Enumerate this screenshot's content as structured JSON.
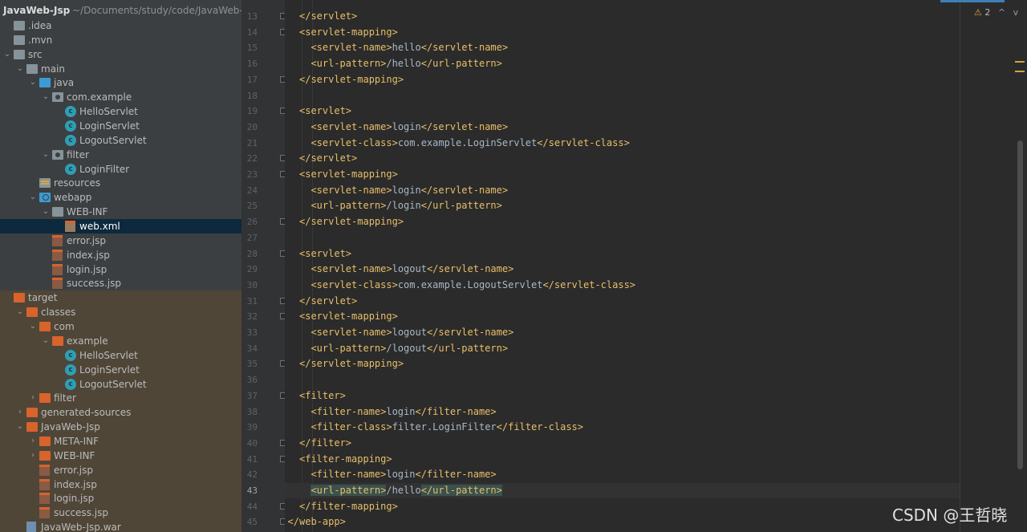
{
  "project": {
    "name": "JavaWeb-Jsp",
    "path": "~/Documents/study/code/JavaWeb-Jsp"
  },
  "tree": [
    {
      "label": ".idea",
      "icon": "folder-icon"
    },
    {
      "label": ".mvn",
      "icon": "folder-icon"
    },
    {
      "label": "src",
      "icon": "folder-icon"
    },
    {
      "label": "main",
      "icon": "folder-icon"
    },
    {
      "label": "java",
      "icon": "source-folder-icon"
    },
    {
      "label": "com.example",
      "icon": "package-icon"
    },
    {
      "label": "HelloServlet",
      "icon": "class-icon"
    },
    {
      "label": "LoginServlet",
      "icon": "class-icon"
    },
    {
      "label": "LogoutServlet",
      "icon": "class-icon"
    },
    {
      "label": "filter",
      "icon": "package-icon"
    },
    {
      "label": "LoginFilter",
      "icon": "class-icon"
    },
    {
      "label": "resources",
      "icon": "resources-folder-icon"
    },
    {
      "label": "webapp",
      "icon": "web-folder-icon"
    },
    {
      "label": "WEB-INF",
      "icon": "folder-icon"
    },
    {
      "label": "web.xml",
      "icon": "xml-file-icon"
    },
    {
      "label": "error.jsp",
      "icon": "jsp-file-icon"
    },
    {
      "label": "index.jsp",
      "icon": "jsp-file-icon"
    },
    {
      "label": "login.jsp",
      "icon": "jsp-file-icon"
    },
    {
      "label": "success.jsp",
      "icon": "jsp-file-icon"
    },
    {
      "label": "target",
      "icon": "excluded-folder-icon"
    },
    {
      "label": "classes",
      "icon": "excluded-folder-icon"
    },
    {
      "label": "com",
      "icon": "excluded-folder-icon"
    },
    {
      "label": "example",
      "icon": "excluded-folder-icon"
    },
    {
      "label": "HelloServlet",
      "icon": "class-icon"
    },
    {
      "label": "LoginServlet",
      "icon": "class-icon"
    },
    {
      "label": "LogoutServlet",
      "icon": "class-icon"
    },
    {
      "label": "filter",
      "icon": "excluded-folder-icon"
    },
    {
      "label": "generated-sources",
      "icon": "excluded-folder-icon"
    },
    {
      "label": "JavaWeb-Jsp",
      "icon": "excluded-folder-icon"
    },
    {
      "label": "META-INF",
      "icon": "excluded-folder-icon"
    },
    {
      "label": "WEB-INF",
      "icon": "excluded-folder-icon"
    },
    {
      "label": "error.jsp",
      "icon": "jsp-file-icon"
    },
    {
      "label": "index.jsp",
      "icon": "jsp-file-icon"
    },
    {
      "label": "login.jsp",
      "icon": "jsp-file-icon"
    },
    {
      "label": "success.jsp",
      "icon": "jsp-file-icon"
    },
    {
      "label": "JavaWeb-Jsp.war",
      "icon": "war-file-icon"
    }
  ],
  "editor": {
    "inspections": {
      "warning_icon": "warning-icon",
      "warning_count": "2",
      "prev": "^",
      "next": "v"
    },
    "lines": [
      {
        "n": "13",
        "code": "</servlet>"
      },
      {
        "n": "14",
        "code": "<servlet-mapping>"
      },
      {
        "n": "15",
        "code": "<servlet-name>hello</servlet-name>"
      },
      {
        "n": "16",
        "code": "<url-pattern>/hello</url-pattern>"
      },
      {
        "n": "17",
        "code": "</servlet-mapping>"
      },
      {
        "n": "18",
        "code": ""
      },
      {
        "n": "19",
        "code": "<servlet>"
      },
      {
        "n": "20",
        "code": "<servlet-name>login</servlet-name>"
      },
      {
        "n": "21",
        "code": "<servlet-class>com.example.LoginServlet</servlet-class>"
      },
      {
        "n": "22",
        "code": "</servlet>"
      },
      {
        "n": "23",
        "code": "<servlet-mapping>"
      },
      {
        "n": "24",
        "code": "<servlet-name>login</servlet-name>"
      },
      {
        "n": "25",
        "code": "<url-pattern>/login</url-pattern>"
      },
      {
        "n": "26",
        "code": "</servlet-mapping>"
      },
      {
        "n": "27",
        "code": ""
      },
      {
        "n": "28",
        "code": "<servlet>"
      },
      {
        "n": "29",
        "code": "<servlet-name>logout</servlet-name>"
      },
      {
        "n": "30",
        "code": "<servlet-class>com.example.LogoutServlet</servlet-class>"
      },
      {
        "n": "31",
        "code": "</servlet>"
      },
      {
        "n": "32",
        "code": "<servlet-mapping>"
      },
      {
        "n": "33",
        "code": "<servlet-name>logout</servlet-name>"
      },
      {
        "n": "34",
        "code": "<url-pattern>/logout</url-pattern>"
      },
      {
        "n": "35",
        "code": "</servlet-mapping>"
      },
      {
        "n": "36",
        "code": ""
      },
      {
        "n": "37",
        "code": "<filter>"
      },
      {
        "n": "38",
        "code": "<filter-name>login</filter-name>"
      },
      {
        "n": "39",
        "code": "<filter-class>filter.LoginFilter</filter-class>"
      },
      {
        "n": "40",
        "code": "</filter>"
      },
      {
        "n": "41",
        "code": "<filter-mapping>"
      },
      {
        "n": "42",
        "code": "<filter-name>login</filter-name>"
      },
      {
        "n": "43",
        "code": "<url-pattern>/hello</url-pattern>"
      },
      {
        "n": "44",
        "code": "</filter-mapping>"
      },
      {
        "n": "45",
        "code": "</web-app>"
      }
    ]
  },
  "watermark": "CSDN @王哲晓",
  "colors": {
    "tree_bg": "#3c3f41",
    "editor_bg": "#2b2b2b",
    "tag": "#e8bf6a",
    "text": "#a9b7c6",
    "selection": "#0d293e"
  }
}
